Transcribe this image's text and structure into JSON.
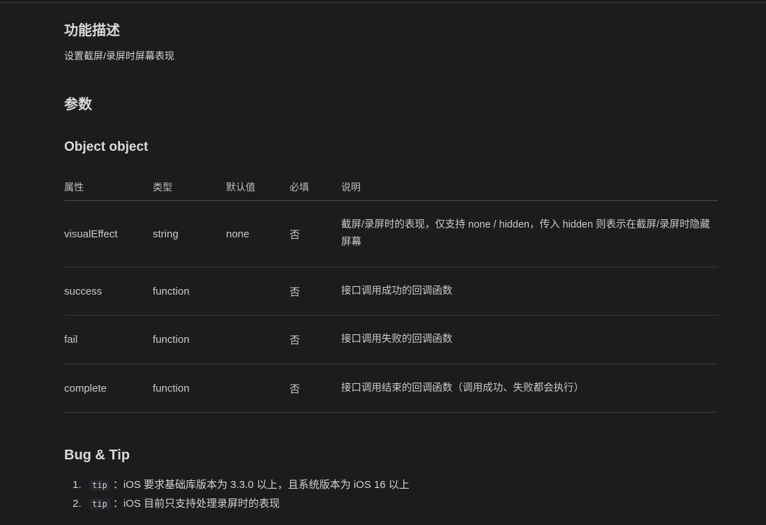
{
  "doc": {
    "feature_heading": "功能描述",
    "feature_description": "设置截屏/录屏时屏幕表现",
    "params_heading": "参数",
    "object_heading": "Object object",
    "table": {
      "headers": [
        "属性",
        "类型",
        "默认值",
        "必填",
        "说明"
      ],
      "rows": [
        {
          "name": "visualEffect",
          "type": "string",
          "default": "none",
          "required": "否",
          "note": "截屏/录屏时的表现，仅支持 none / hidden，传入 hidden 则表示在截屏/录屏时隐藏屏幕"
        },
        {
          "name": "success",
          "type": "function",
          "default": "",
          "required": "否",
          "note": "接口调用成功的回调函数"
        },
        {
          "name": "fail",
          "type": "function",
          "default": "",
          "required": "否",
          "note": "接口调用失败的回调函数"
        },
        {
          "name": "complete",
          "type": "function",
          "default": "",
          "required": "否",
          "note": "接口调用结束的回调函数（调用成功、失败都会执行）"
        }
      ]
    },
    "bug_heading": "Bug & Tip",
    "tips": [
      {
        "num": "1.",
        "tag": "tip",
        "text": "：iOS 要求基础库版本为 3.3.0 以上，且系统版本为 iOS 16 以上"
      },
      {
        "num": "2.",
        "tag": "tip",
        "text": "：iOS 目前只支持处理录屏时的表现"
      }
    ]
  }
}
